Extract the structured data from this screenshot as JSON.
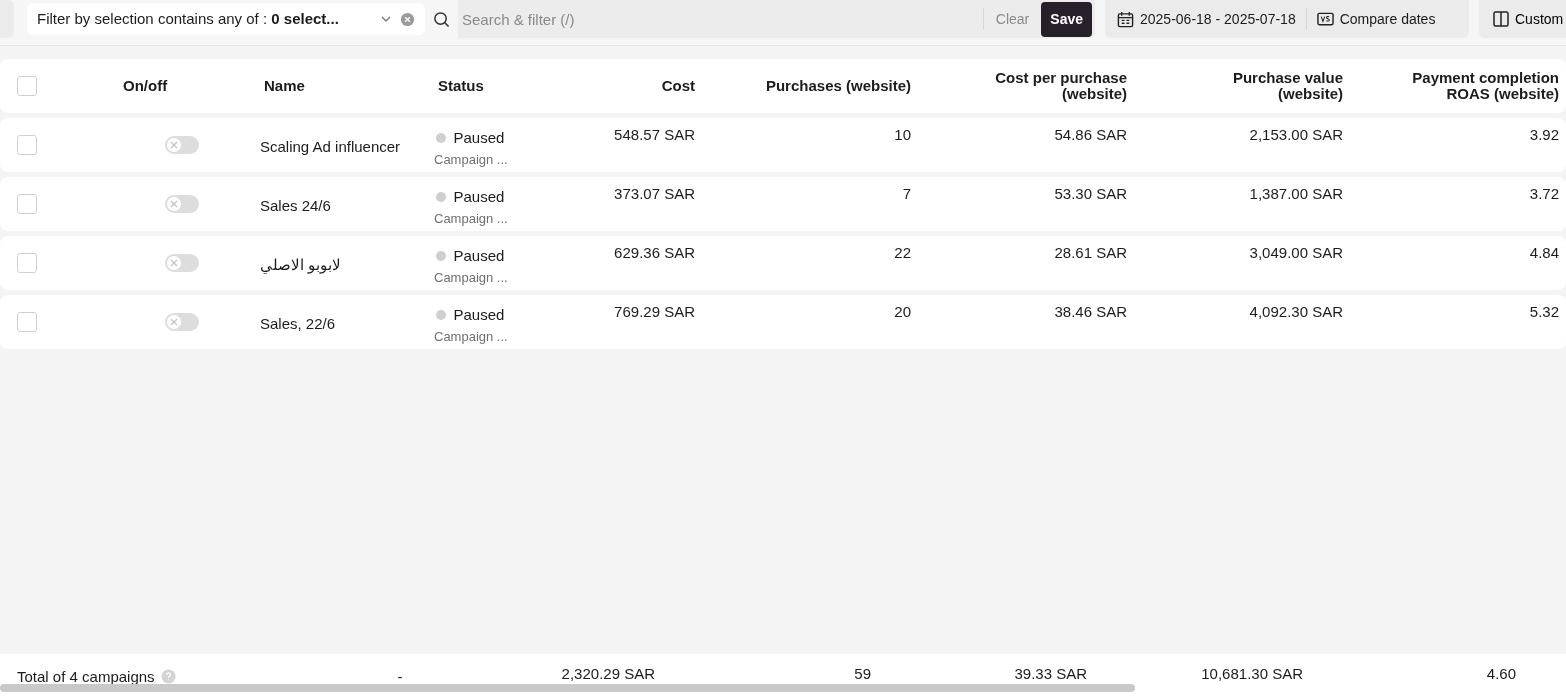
{
  "toolbar": {
    "filter": {
      "label": "Filter by selection contains any of :",
      "value": "0 select..."
    },
    "search": {
      "placeholder": "Search & filter (/)"
    },
    "clear": "Clear",
    "save": "Save",
    "date_range": "2025-06-18 - 2025-07-18",
    "compare": "Compare dates",
    "custom": "Custom"
  },
  "table": {
    "select_all": {
      "checked": false
    },
    "columns": [
      "On/off",
      "Name",
      "Status",
      "Cost",
      "Purchases (website)",
      "Cost per purchase (website)",
      "Purchase value (website)",
      "Payment completion ROAS (website)"
    ],
    "rows": [
      {
        "checked": false,
        "on": false,
        "name": "Scaling Ad influencer",
        "status": "Paused",
        "status_detail": "Campaign ...",
        "cost": "548.57 SAR",
        "purchases": "10",
        "cost_per_purchase": "54.86 SAR",
        "purchase_value": "2,153.00 SAR",
        "roas": "3.92"
      },
      {
        "checked": false,
        "on": false,
        "name": "Sales 24/6",
        "status": "Paused",
        "status_detail": "Campaign ...",
        "cost": "373.07 SAR",
        "purchases": "7",
        "cost_per_purchase": "53.30 SAR",
        "purchase_value": "1,387.00 SAR",
        "roas": "3.72"
      },
      {
        "checked": false,
        "on": false,
        "name": "لابوبو الاصلي",
        "status": "Paused",
        "status_detail": "Campaign ...",
        "cost": "629.36 SAR",
        "purchases": "22",
        "cost_per_purchase": "28.61 SAR",
        "purchase_value": "3,049.00 SAR",
        "roas": "4.84"
      },
      {
        "checked": false,
        "on": false,
        "name": "Sales, 22/6",
        "status": "Paused",
        "status_detail": "Campaign ...",
        "cost": "769.29 SAR",
        "purchases": "20",
        "cost_per_purchase": "38.46 SAR",
        "purchase_value": "4,092.30 SAR",
        "roas": "5.32"
      }
    ],
    "totals": {
      "label": "Total of 4 campaigns",
      "on_off": "-",
      "cost": "2,320.29 SAR",
      "purchases": "59",
      "cost_per_purchase": "39.33 SAR",
      "purchase_value": "10,681.30 SAR",
      "roas": "4.60"
    }
  }
}
